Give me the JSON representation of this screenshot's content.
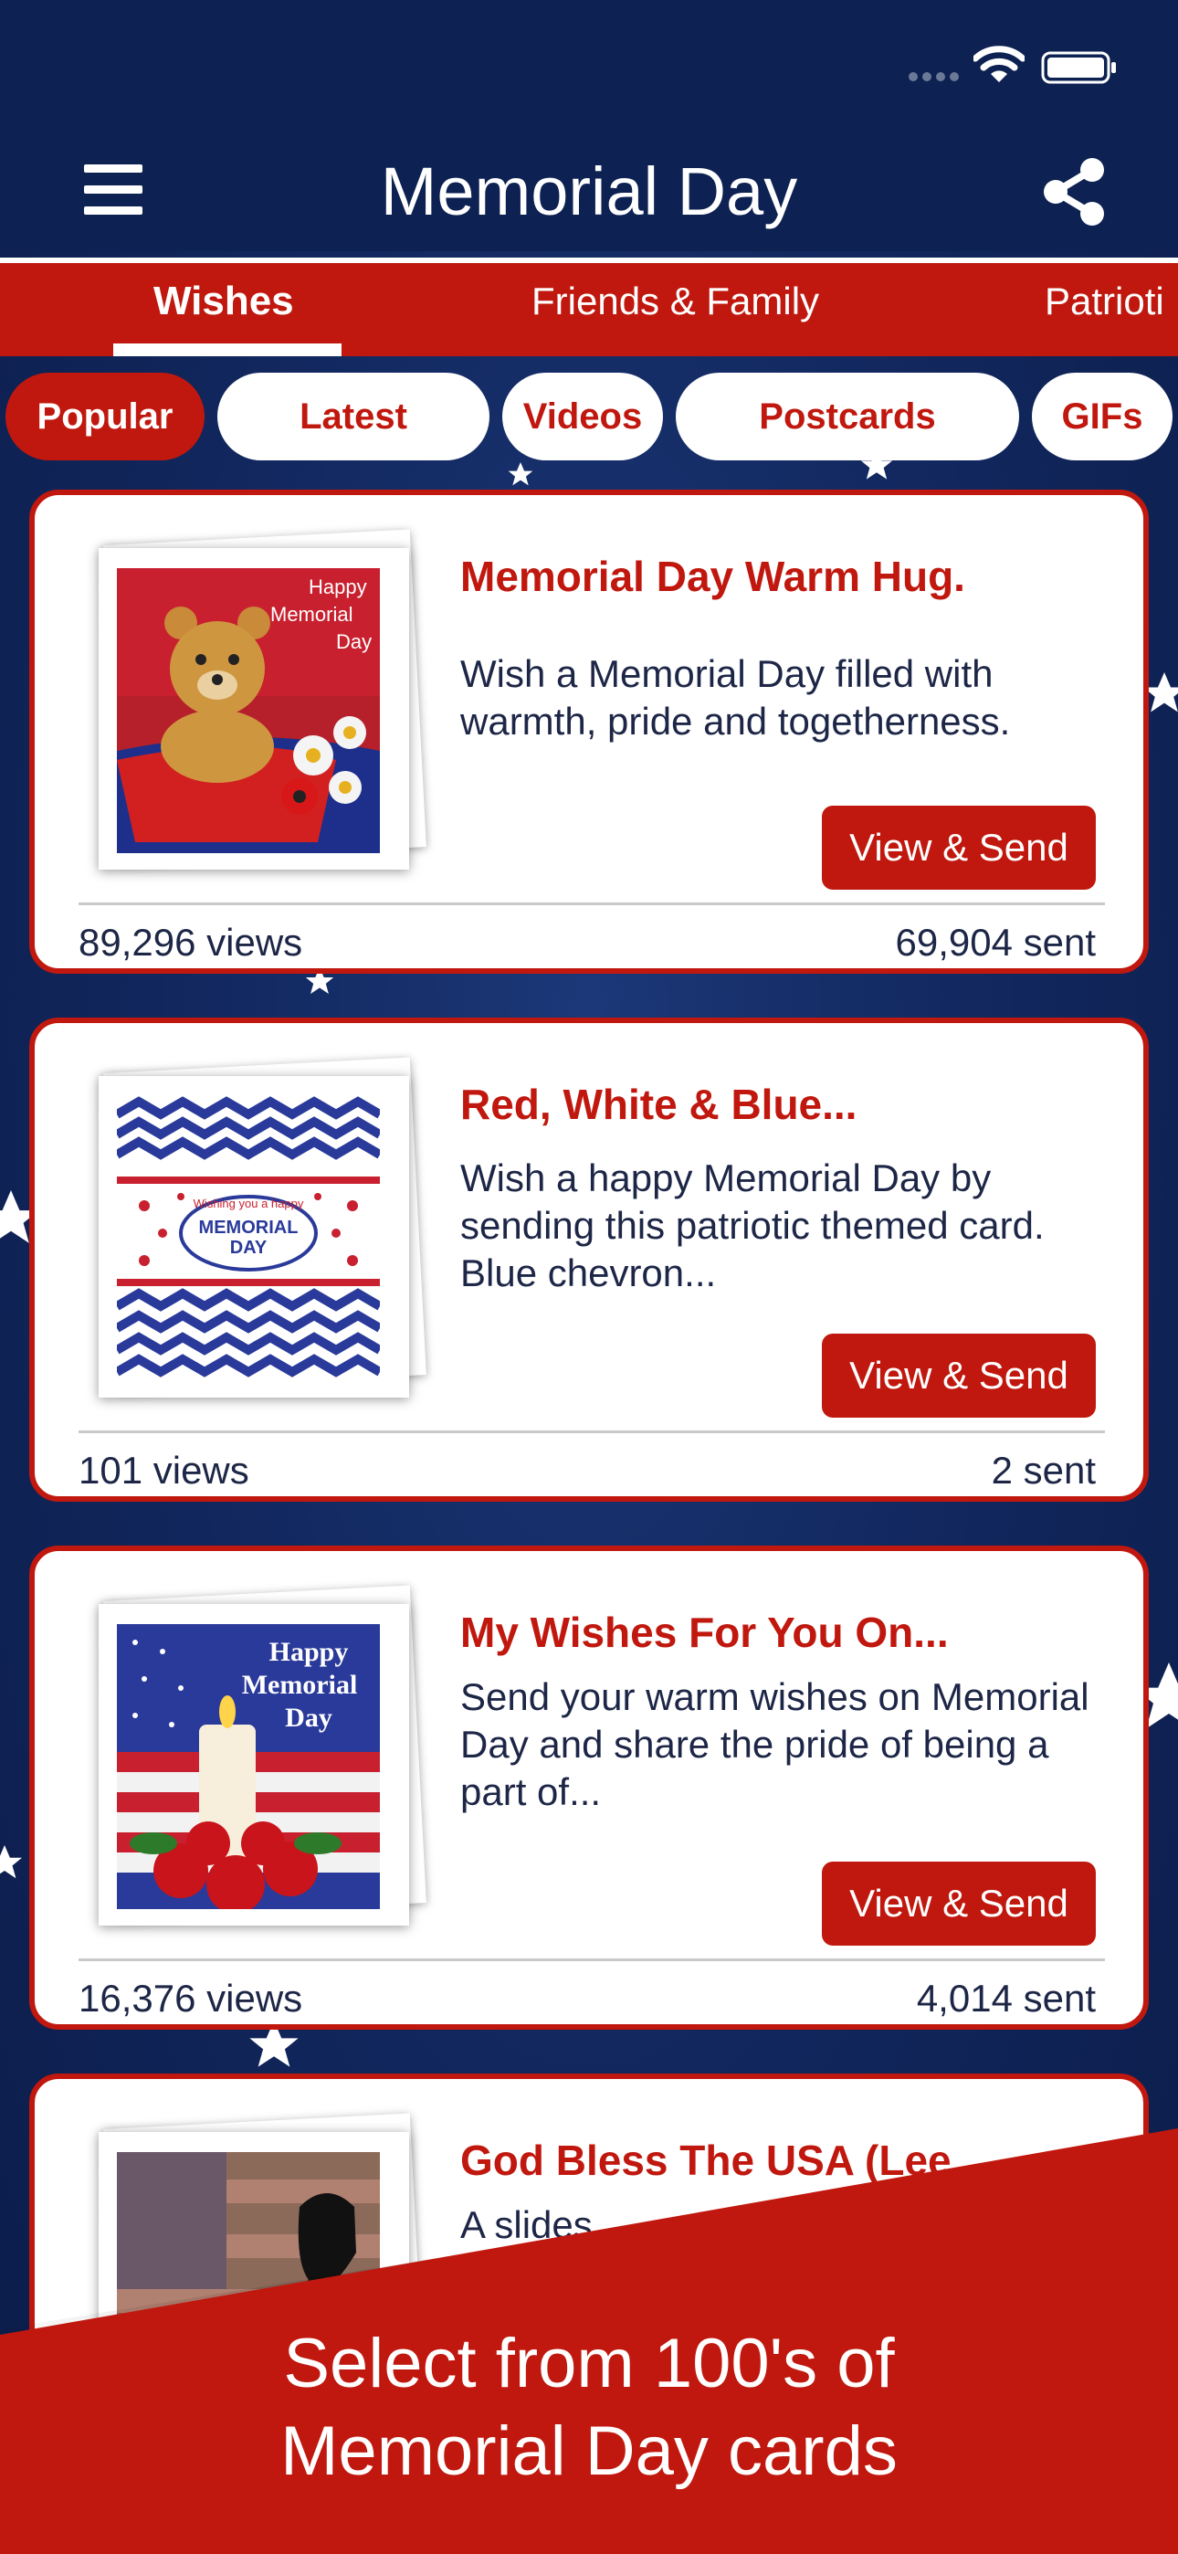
{
  "app_bar": {
    "title": "Memorial Day"
  },
  "tabs": [
    {
      "label": "Wishes",
      "active": true
    },
    {
      "label": "Friends & Family",
      "active": false
    },
    {
      "label": "Patrioti",
      "active": false
    }
  ],
  "filters": [
    {
      "label": "Popular",
      "active": true
    },
    {
      "label": "Latest",
      "active": false
    },
    {
      "label": "Videos",
      "active": false
    },
    {
      "label": "Postcards",
      "active": false
    },
    {
      "label": "GIFs",
      "active": false
    }
  ],
  "cards": [
    {
      "title": "Memorial Day Warm Hug.",
      "description": "Wish a Memorial Day filled with warmth, pride and togetherness.",
      "button": "View & Send",
      "views": "89,296 views",
      "sent": "69,904 sent",
      "thumb_text": "Happy Memorial Day"
    },
    {
      "title": "Red, White & Blue...",
      "description": "Wish a happy Memorial Day by sending this patriotic themed card. Blue chevron...",
      "button": "View & Send",
      "views": "101 views",
      "sent": "2 sent",
      "thumb_text": "MEMORIAL DAY",
      "thumb_subtext": "Wishing you a happy"
    },
    {
      "title": "My Wishes For You On...",
      "description": "Send your warm wishes on Memorial Day and share the pride of being a part of...",
      "button": "View & Send",
      "views": "16,376 views",
      "sent": "4,014 sent",
      "thumb_text": "Happy Memorial Day"
    },
    {
      "title": "God Bless The USA (Lee",
      "description": "A slides"
    }
  ],
  "banner": {
    "line1": "Select from 100's of",
    "line2": "Memorial Day cards"
  },
  "colors": {
    "navy": "#0d2152",
    "red": "#c0180e",
    "text_dark": "#1d2646"
  },
  "icons": [
    "menu-icon",
    "share-icon",
    "wifi-icon",
    "battery-icon",
    "signal-dots-icon"
  ]
}
